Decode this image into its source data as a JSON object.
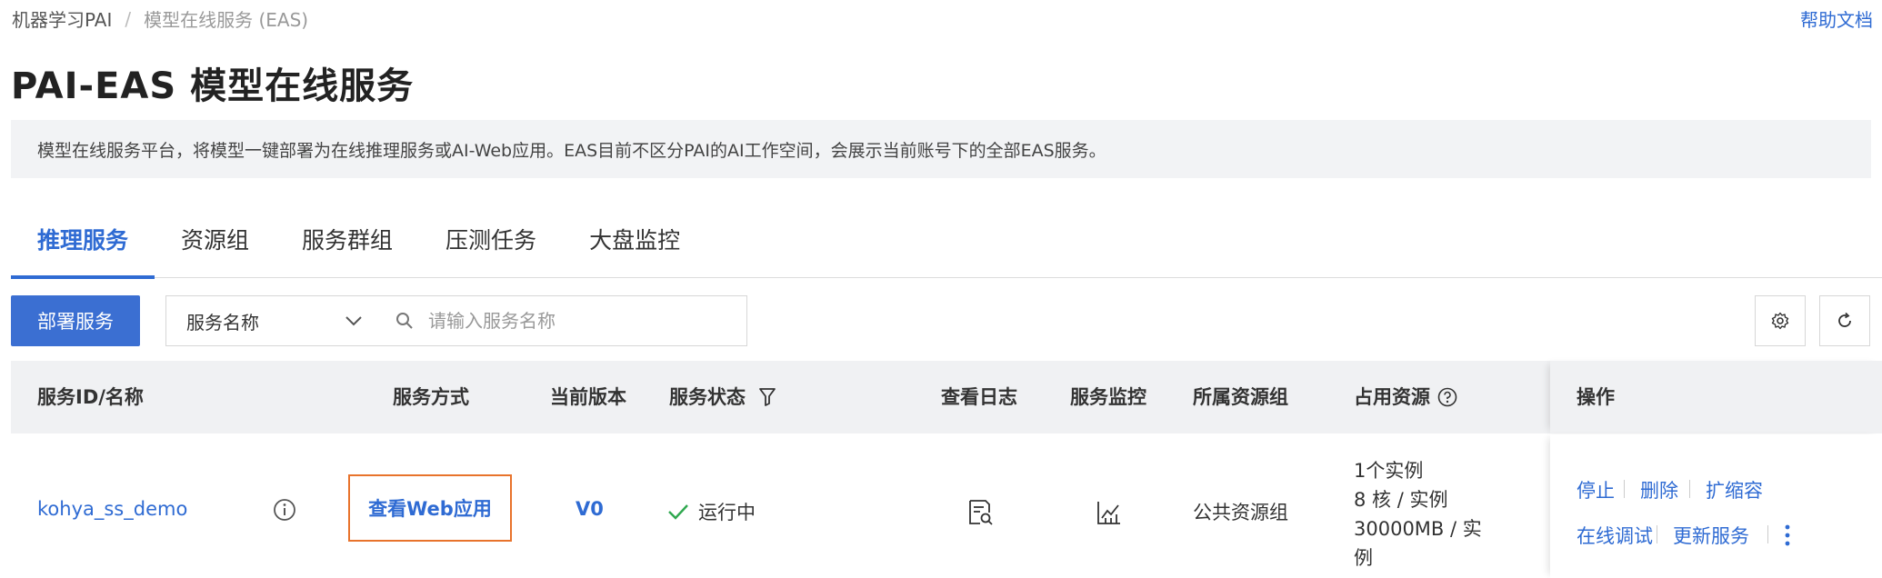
{
  "breadcrumb": {
    "root": "机器学习PAI",
    "separator": "/",
    "current": "模型在线服务 (EAS)"
  },
  "help_link": "帮助文档",
  "page_title": "PAI-EAS 模型在线服务",
  "notice": "模型在线服务平台，将模型一键部署为在线推理服务或AI-Web应用。EAS目前不区分PAI的AI工作空间，会展示当前账号下的全部EAS服务。",
  "tabs": [
    {
      "label": "推理服务",
      "active": true
    },
    {
      "label": "资源组",
      "active": false
    },
    {
      "label": "服务群组",
      "active": false
    },
    {
      "label": "压测任务",
      "active": false
    },
    {
      "label": "大盘监控",
      "active": false
    }
  ],
  "toolbar": {
    "deploy_label": "部署服务",
    "search_field": "服务名称",
    "search_placeholder": "请输入服务名称",
    "settings_icon": "gear-icon",
    "refresh_icon": "refresh-icon"
  },
  "table": {
    "headers": {
      "id_name": "服务ID/名称",
      "method": "服务方式",
      "version": "当前版本",
      "status": "服务状态",
      "logs": "查看日志",
      "monitor": "服务监控",
      "resource_group": "所属资源组",
      "resources": "占用资源",
      "ops": "操作"
    },
    "rows": [
      {
        "name": "kohya_ss_demo",
        "method": "查看Web应用",
        "version": "V0",
        "status": "运行中",
        "resource_group": "公共资源组",
        "res_line1": "1个实例",
        "res_line2": "8 核 / 实例",
        "res_line3": "30000MB / 实",
        "res_line4": "例",
        "ops": {
          "stop": "停止",
          "delete": "删除",
          "scale": "扩缩容",
          "debug": "在线调试",
          "update": "更新服务"
        }
      }
    ]
  },
  "colors": {
    "accent": "#2f6bd3",
    "highlight_border": "#e8732c",
    "status_ok": "#2fa84f"
  }
}
